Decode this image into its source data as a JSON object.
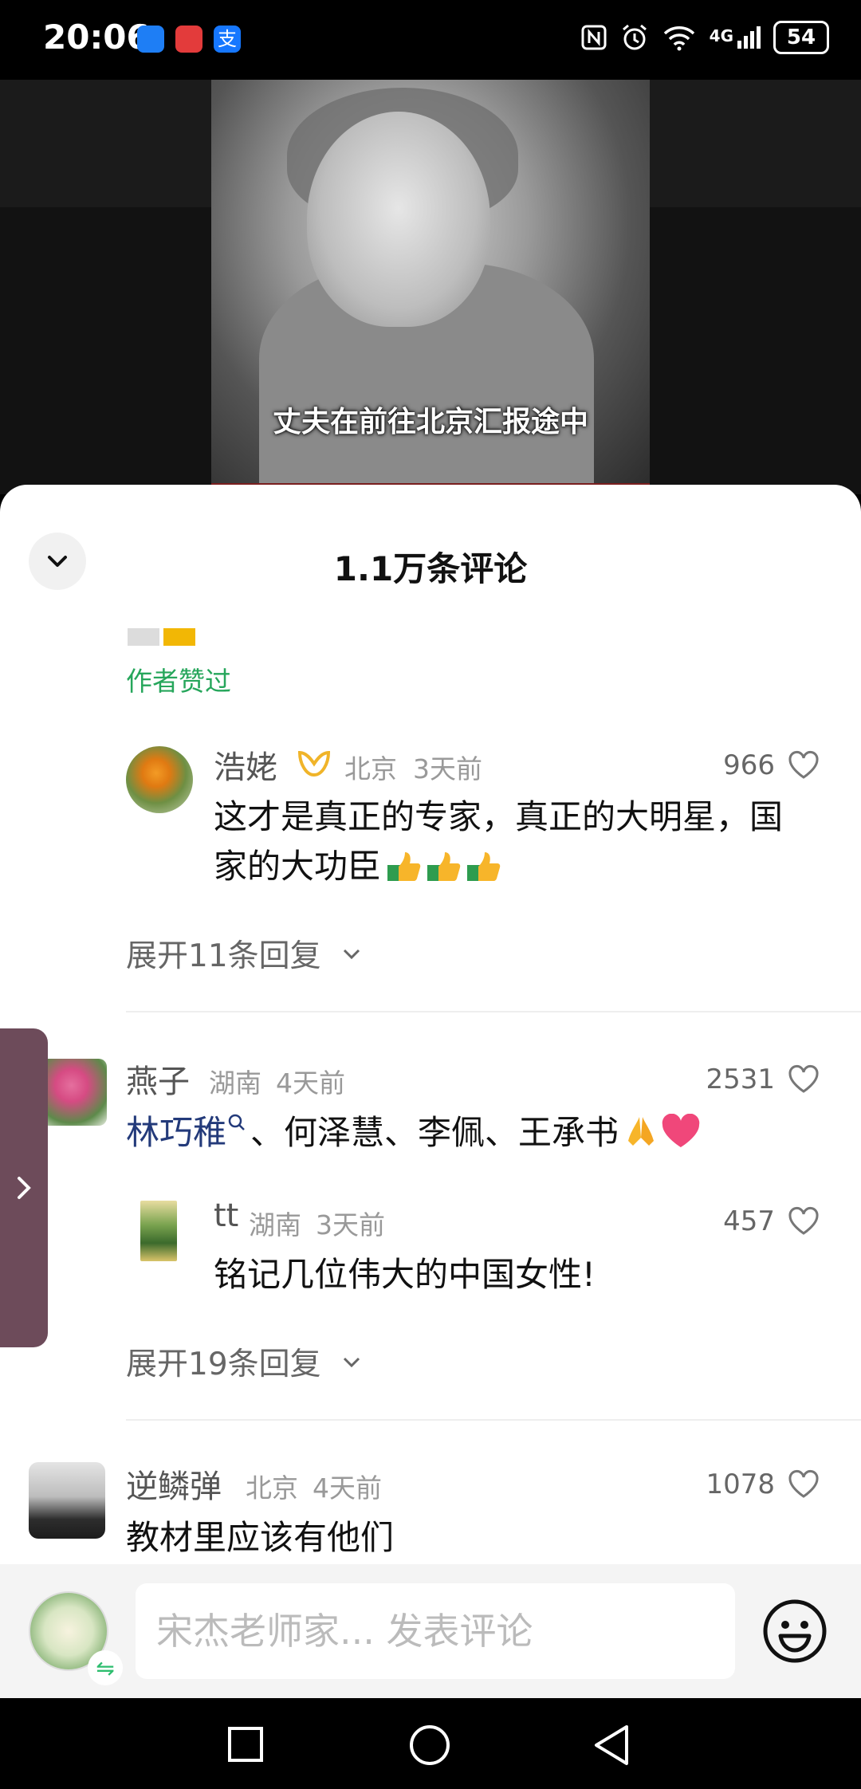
{
  "status_bar": {
    "time": "20:06",
    "network": "4G",
    "battery": "54"
  },
  "video": {
    "caption": "丈夫在前往北京汇报途中"
  },
  "sheet": {
    "title": "1.1万条评论",
    "author_liked": "作者赞过"
  },
  "comments": [
    {
      "name": "浩姥",
      "location": "北京",
      "time": "3天前",
      "likes": "966",
      "text_line1": "这才是真正的专家，真正的大明星，国",
      "text_line2": "家的大功臣",
      "expand": "展开11条回复"
    },
    {
      "name": "燕子",
      "location": "湖南",
      "time": "4天前",
      "likes": "2531",
      "mention": "林巧稚",
      "text": "、何泽慧、李佩、王承书",
      "reply": {
        "name": "tt",
        "location": "湖南",
        "time": "3天前",
        "likes": "457",
        "text": "铭记几位伟大的中国女性!"
      },
      "expand": "展开19条回复"
    },
    {
      "name": "逆鳞弹",
      "location": "北京",
      "time": "4天前",
      "likes": "1078",
      "text": "教材里应该有他们"
    }
  ],
  "input": {
    "placeholder": "宋杰老师家... 发表评论"
  }
}
